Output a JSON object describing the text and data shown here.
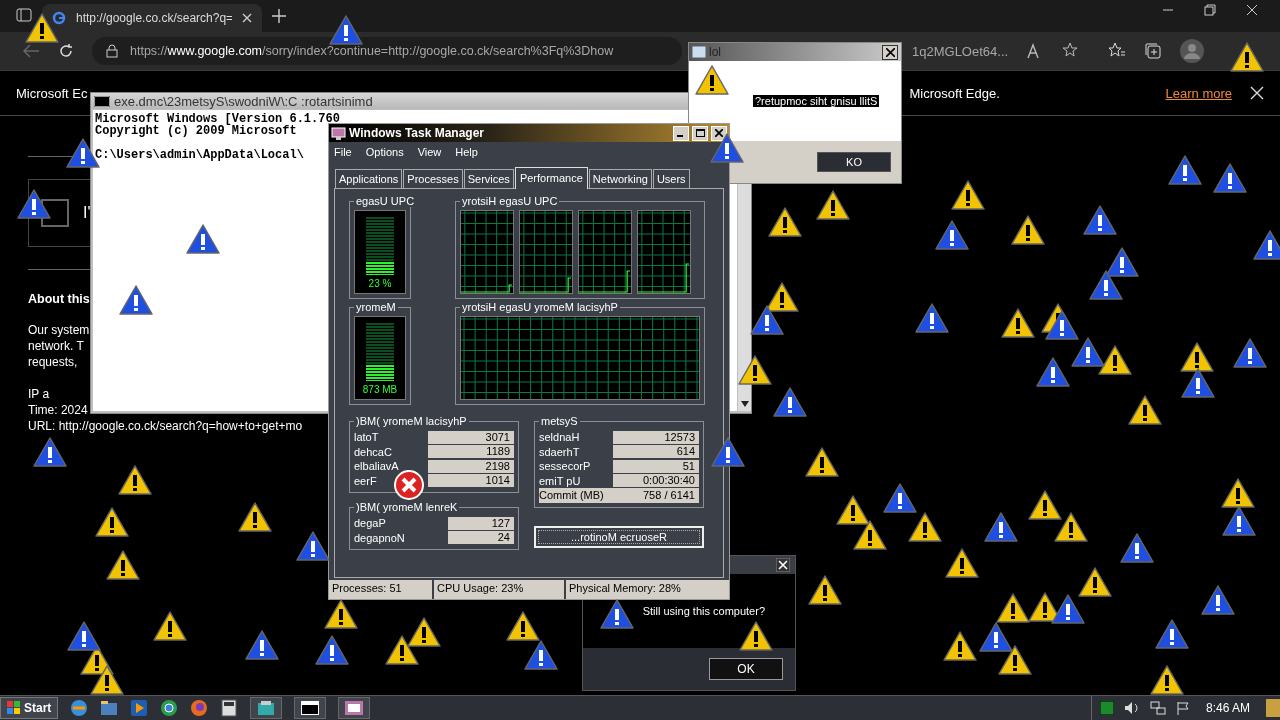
{
  "browser": {
    "tab_title": "http://google.co.ck/search?q=",
    "address": {
      "scheme": "https://",
      "host": "www.google.com",
      "path": "/sorry/index?continue=http://google.co.ck/search%3Fq%3Dhow",
      "tail": "1q2MGLOet64..."
    },
    "infobar": {
      "left_text": "Microsoft Ec",
      "right_text": "Microsoft Edge.",
      "link": "Learn more"
    },
    "page": {
      "checkbox_checked": false,
      "checkbox_label": "I'",
      "heading": "About this",
      "lines": [
        "Our system",
        "network. T",
        "requests,"
      ],
      "ip": "IP a",
      "time": "Time: 2024",
      "url": "URL: http://google.co.ck/search?q=how+to+get+mo"
    }
  },
  "cmd": {
    "title": "exe.dmc\\23metsyS\\swodniW\\:C :rotartsinimd",
    "lines": [
      "Microsoft Windows [Version 6.1.760",
      "Copyright (c) 2009 Microsoft",
      "C:\\Users\\admin\\AppData\\Local\\"
    ]
  },
  "task_manager": {
    "title": "Windows Task Manager",
    "menu": [
      "File",
      "Options",
      "View",
      "Help"
    ],
    "tabs": [
      {
        "label": "Applications",
        "selected": false
      },
      {
        "label": "Processes",
        "selected": false
      },
      {
        "label": "Services",
        "selected": false
      },
      {
        "label": "Performance",
        "selected": true
      },
      {
        "label": "Networking",
        "selected": false
      },
      {
        "label": "Users",
        "selected": false
      }
    ],
    "cpu": {
      "title": "egasU UPC",
      "reading": "23 %",
      "level": 0.23
    },
    "cpu_history": {
      "title": "yrotsiH egasU UPC"
    },
    "memory": {
      "title": "yromeM",
      "reading": "873 MB",
      "level": 0.28
    },
    "memory_history": {
      "title": "yrotsiH egasU yromeM lacisyhP"
    },
    "physical_memory": {
      "title": ")BM( yromeM lacisyhP",
      "rows": [
        {
          "label": "latoT",
          "value": "3071"
        },
        {
          "label": "dehcaC",
          "value": "1189"
        },
        {
          "label": "elbaliavA",
          "value": "2198"
        },
        {
          "label": "eerF",
          "value": "1014"
        }
      ]
    },
    "kernel_memory": {
      "title": ")BM( yromeM lenreK",
      "rows": [
        {
          "label": "degaP",
          "value": "127"
        },
        {
          "label": "degapnoN",
          "value": "24"
        }
      ]
    },
    "system": {
      "title": "metsyS",
      "rows": [
        {
          "label": "seldnaH",
          "value": "12573",
          "highlighted": false
        },
        {
          "label": "sdaerhT",
          "value": "614",
          "highlighted": false
        },
        {
          "label": "sessecorP",
          "value": "51",
          "highlighted": false
        },
        {
          "label": "emiT pU",
          "value": "0:00:30:40",
          "highlighted": false
        },
        {
          "label": "Commit (MB)",
          "value": "758 / 6141",
          "highlighted": true
        }
      ]
    },
    "resource_button": "...rotinoM ecruoseR",
    "status": [
      "Processes: 51",
      "CPU Usage: 23%",
      "Physical Memory: 28%"
    ]
  },
  "lol_dialog": {
    "title": "lol",
    "message": "?retupmoc siht gnisu llitS",
    "button": "KO"
  },
  "still_dialog": {
    "message": "Still using this computer?",
    "button": "OK"
  },
  "taskbar": {
    "start": "Start",
    "clock": "8:46 AM"
  }
}
